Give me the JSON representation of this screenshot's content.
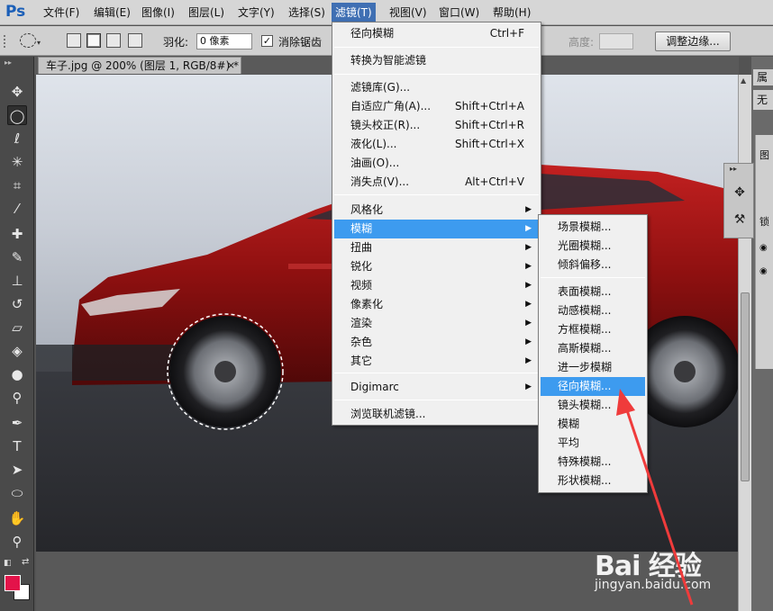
{
  "app": {
    "logo": "Ps"
  },
  "menubar": {
    "items": [
      {
        "label": "文件(F)"
      },
      {
        "label": "编辑(E)"
      },
      {
        "label": "图像(I)"
      },
      {
        "label": "图层(L)"
      },
      {
        "label": "文字(Y)"
      },
      {
        "label": "选择(S)"
      },
      {
        "label": "滤镜(T)"
      },
      {
        "label": "视图(V)"
      },
      {
        "label": "窗口(W)"
      },
      {
        "label": "帮助(H)"
      }
    ]
  },
  "options": {
    "feather_label": "羽化:",
    "feather_value": "0 像素",
    "antialias_label": "消除锯齿",
    "antialias_checked": "✓",
    "height_label": "高度:",
    "refine_edge_label": "调整边缘..."
  },
  "document": {
    "tab_title": "车子.jpg @ 200% (图层 1, RGB/8#) *"
  },
  "filter_menu": {
    "last_filter": {
      "label": "径向模糊",
      "shortcut": "Ctrl+F"
    },
    "smart": {
      "label": "转换为智能滤镜"
    },
    "group1": [
      {
        "label": "滤镜库(G)...",
        "shortcut": ""
      },
      {
        "label": "自适应广角(A)...",
        "shortcut": "Shift+Ctrl+A"
      },
      {
        "label": "镜头校正(R)...",
        "shortcut": "Shift+Ctrl+R"
      },
      {
        "label": "液化(L)...",
        "shortcut": "Shift+Ctrl+X"
      },
      {
        "label": "油画(O)...",
        "shortcut": ""
      },
      {
        "label": "消失点(V)...",
        "shortcut": "Alt+Ctrl+V"
      }
    ],
    "group2": [
      {
        "label": "风格化"
      },
      {
        "label": "模糊"
      },
      {
        "label": "扭曲"
      },
      {
        "label": "锐化"
      },
      {
        "label": "视频"
      },
      {
        "label": "像素化"
      },
      {
        "label": "渲染"
      },
      {
        "label": "杂色"
      },
      {
        "label": "其它"
      }
    ],
    "digimarc": {
      "label": "Digimarc"
    },
    "browse": {
      "label": "浏览联机滤镜..."
    }
  },
  "blur_menu": {
    "group1": [
      {
        "label": "场景模糊..."
      },
      {
        "label": "光圈模糊..."
      },
      {
        "label": "倾斜偏移..."
      }
    ],
    "group2": [
      {
        "label": "表面模糊..."
      },
      {
        "label": "动感模糊..."
      },
      {
        "label": "方框模糊..."
      },
      {
        "label": "高斯模糊..."
      },
      {
        "label": "进一步模糊"
      },
      {
        "label": "径向模糊..."
      },
      {
        "label": "镜头模糊..."
      },
      {
        "label": "模糊"
      },
      {
        "label": "平均"
      },
      {
        "label": "特殊模糊..."
      },
      {
        "label": "形状模糊..."
      }
    ]
  },
  "right_dock": {
    "label1": "属",
    "label2": "无",
    "label3": "图",
    "label4": "锁"
  },
  "colors": {
    "foreground": "#e3134a",
    "background": "#ffffff",
    "menu_highlight": "#3d9bef",
    "annotation_arrow": "#ef3b3b"
  },
  "watermark": {
    "brand": "Bai 经验",
    "url": "jingyan.baidu.com"
  }
}
